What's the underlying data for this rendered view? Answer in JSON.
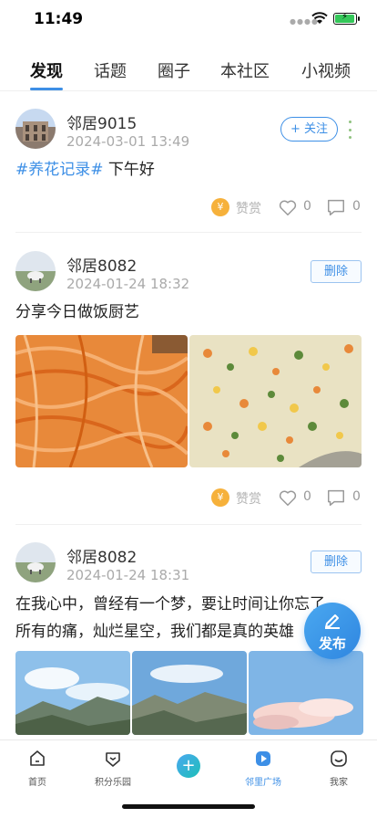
{
  "status_bar": {
    "time": "11:49"
  },
  "tabs": [
    {
      "label": "发现",
      "active": true
    },
    {
      "label": "话题"
    },
    {
      "label": "圈子"
    },
    {
      "label": "本社区"
    },
    {
      "label": "小视频"
    }
  ],
  "posts": [
    {
      "username": "邻居9015",
      "time": "2024-03-01 13:49",
      "action_label": "+ 关注",
      "hashtag": "#养花记录#",
      "text": " 下午好",
      "reward_label": "赞赏",
      "likes": "0",
      "comments": "0"
    },
    {
      "username": "邻居8082",
      "time": "2024-01-24 18:32",
      "action_label": "删除",
      "text": "分享今日做饭厨艺",
      "reward_label": "赞赏",
      "likes": "0",
      "comments": "0"
    },
    {
      "username": "邻居8082",
      "time": "2024-01-24 18:31",
      "action_label": "删除",
      "text_line1": "在我心中，曾经有一个梦，要让时间让你忘了",
      "text_line2": "所有的痛，灿烂星空，我们都是真的英雄"
    }
  ],
  "fab": {
    "label": "发布"
  },
  "tabbar": [
    {
      "label": "首页",
      "icon": "home-icon"
    },
    {
      "label": "积分乐园",
      "icon": "points-icon"
    },
    {
      "label": "",
      "icon": "plus-icon"
    },
    {
      "label": "邻里广场",
      "icon": "square-icon",
      "active": true
    },
    {
      "label": "我家",
      "icon": "profile-icon"
    }
  ],
  "colors": {
    "accent": "#3d8fe6",
    "coin": "#f6b13b",
    "more_dots": "#8fc27f"
  }
}
